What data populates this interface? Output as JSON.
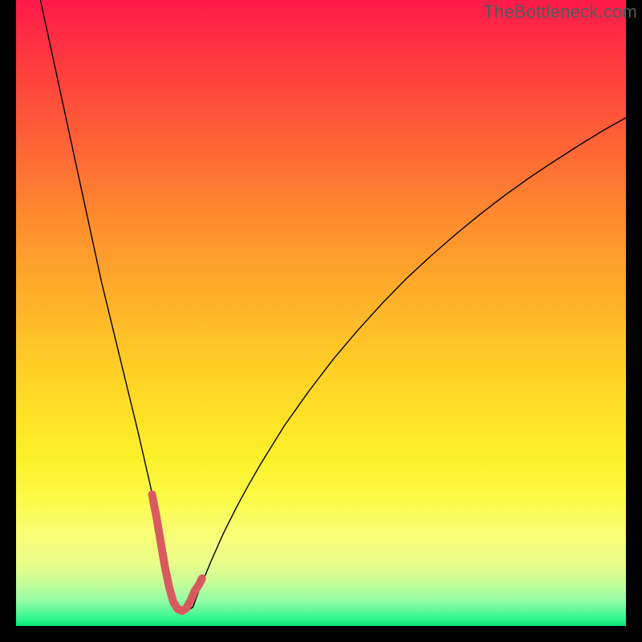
{
  "watermark": "TheBottleneck.com",
  "chart_data": {
    "type": "line",
    "title": "",
    "xlabel": "",
    "ylabel": "",
    "xlim": [
      0,
      100
    ],
    "ylim": [
      0,
      100
    ],
    "grid": false,
    "legend": false,
    "series": [
      {
        "name": "curve-black",
        "color": "#000000",
        "stroke_width": 1.4,
        "x": [
          4,
          6,
          8,
          10,
          12,
          14,
          16,
          18,
          20,
          22,
          23,
          24,
          25,
          26,
          27,
          28,
          29,
          30,
          32,
          34,
          36,
          38,
          40,
          44,
          48,
          52,
          56,
          60,
          64,
          68,
          72,
          76,
          80,
          84,
          88,
          92,
          96,
          100
        ],
        "values": [
          100,
          91,
          82,
          73,
          64,
          55,
          47,
          39,
          31,
          22.5,
          18,
          13,
          8,
          4.5,
          2.7,
          2.4,
          3.0,
          5.7,
          10.4,
          14.8,
          18.7,
          22.3,
          25.7,
          32.0,
          37.5,
          42.6,
          47.2,
          51.5,
          55.5,
          59.1,
          62.5,
          65.7,
          68.7,
          71.5,
          74.1,
          76.6,
          79.0,
          81.2
        ]
      },
      {
        "name": "highlight-pink",
        "color": "#d85a5f",
        "stroke_width": 10,
        "x": [
          22.3,
          23.0,
          23.7,
          24.4,
          25.1,
          25.8,
          26.5,
          27.2,
          27.9,
          28.6,
          29.3,
          30.0,
          30.5
        ],
        "values": [
          21.0,
          17.5,
          13.5,
          9.5,
          6.2,
          3.8,
          2.7,
          2.4,
          2.8,
          4.0,
          5.6,
          6.6,
          7.6
        ]
      }
    ]
  }
}
